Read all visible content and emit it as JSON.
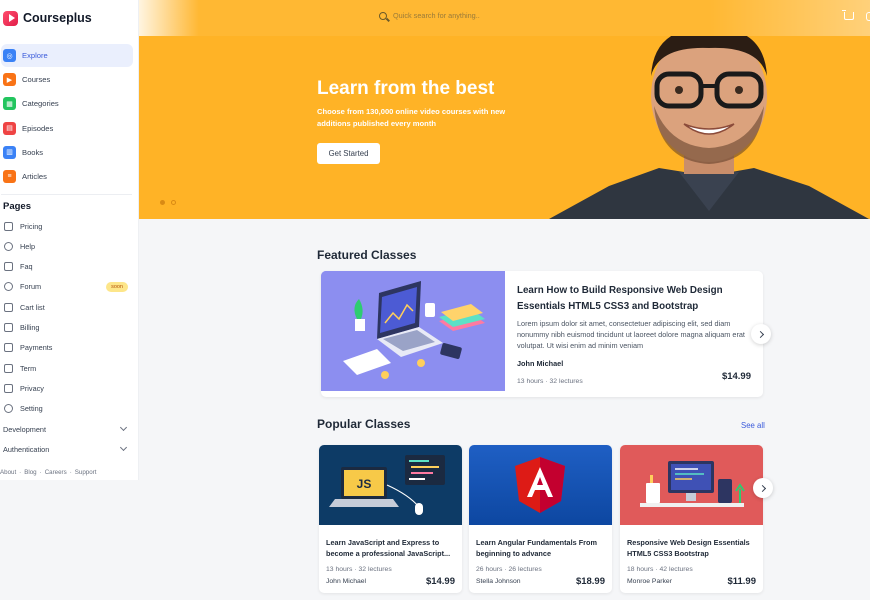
{
  "brand": {
    "name": "Courseplus"
  },
  "nav": [
    {
      "label": "Explore",
      "icon": "compass-icon",
      "color": "#3b82f6",
      "active": true
    },
    {
      "label": "Courses",
      "icon": "play-circle-icon",
      "color": "#f97316"
    },
    {
      "label": "Categories",
      "icon": "grid-icon",
      "color": "#22c55e"
    },
    {
      "label": "Episodes",
      "icon": "film-icon",
      "color": "#ef4444"
    },
    {
      "label": "Books",
      "icon": "book-icon",
      "color": "#3b82f6"
    },
    {
      "label": "Articles",
      "icon": "document-icon",
      "color": "#f97316"
    }
  ],
  "pages_section": {
    "title": "Pages",
    "items": [
      {
        "label": "Pricing",
        "icon": "credit-card-icon"
      },
      {
        "label": "Help",
        "icon": "help-circle-icon"
      },
      {
        "label": "Faq",
        "icon": "chat-icon"
      },
      {
        "label": "Forum",
        "icon": "forum-icon",
        "badge": "soon"
      },
      {
        "label": "Cart list",
        "icon": "cart-list-icon"
      },
      {
        "label": "Billing",
        "icon": "receipt-icon"
      },
      {
        "label": "Payments",
        "icon": "wallet-icon"
      },
      {
        "label": "Term",
        "icon": "file-icon"
      },
      {
        "label": "Privacy",
        "icon": "lock-file-icon"
      },
      {
        "label": "Setting",
        "icon": "gear-icon"
      }
    ],
    "collapsibles": [
      {
        "label": "Development"
      },
      {
        "label": "Authentication"
      }
    ]
  },
  "footer_links": [
    "About",
    "Blog",
    "Careers",
    "Support"
  ],
  "footer_sep": "·",
  "search": {
    "placeholder": "Quick search for anything.."
  },
  "hero": {
    "title": "Learn from the best",
    "subtitle": "Choose from 130,000 online video courses with new additions published every month",
    "button": "Get Started"
  },
  "featured": {
    "heading": "Featured Classes",
    "course": {
      "title": "Learn How to Build Responsive Web Design Essentials HTML5 CSS3 and Bootstrap",
      "description": "Lorem ipsum dolor sit amet, consectetuer adipiscing elit, sed diam nonummy nibh euismod tincidunt ut laoreet dolore magna aliquam erat volutpat. Ut wisi enim ad minim veniam",
      "author": "John Michael",
      "meta": "13 hours  ·  32 lectures",
      "price": "$14.99"
    }
  },
  "popular": {
    "heading": "Popular Classes",
    "see_all": "See all",
    "courses": [
      {
        "title": "Learn JavaScript and Express to become a professional JavaScript...",
        "meta": "13 hours  ·  32 lectures",
        "author": "John Michael",
        "price": "$14.99",
        "bg": "#0d3b66"
      },
      {
        "title": "Learn Angular Fundamentals From beginning to advance",
        "meta": "26 hours  ·  26 lectures",
        "author": "Stella Johnson",
        "price": "$18.99",
        "bg": "#1565c0"
      },
      {
        "title": "Responsive Web Design Essentials HTML5 CSS3 Bootstrap",
        "meta": "18 hours  ·  42 lectures",
        "author": "Monroe Parker",
        "price": "$11.99",
        "bg": "#e05a5a"
      }
    ]
  },
  "colors": {
    "hero_bg": "#ffb326",
    "accent": "#3b5bdb"
  },
  "carousel": {
    "slides": 2,
    "active": 0
  }
}
